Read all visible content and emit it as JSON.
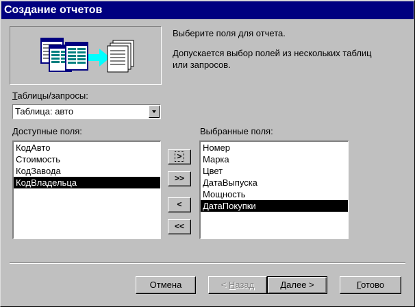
{
  "window": {
    "title": "Создание отчетов"
  },
  "intro": {
    "line1": "Выберите поля для отчета.",
    "line2": "Допускается выбор полей из нескольких таблиц",
    "line3": "или запросов."
  },
  "source": {
    "label_first": "Т",
    "label_rest": "аблицы/запросы:",
    "value": "Таблица: авто"
  },
  "available": {
    "label_first": "Д",
    "label_rest": "оступные поля:",
    "items": [
      "КодАвто",
      "Стоимость",
      "КодЗавода",
      "КодВладельца"
    ],
    "selected_index": 3
  },
  "chosen": {
    "label": "Выбранные поля:",
    "items": [
      "Номер",
      "Марка",
      "Цвет",
      "ДатаВыпуска",
      "Мощность",
      "ДатаПокупки"
    ],
    "selected_index": 5
  },
  "move_buttons": {
    "add": ">",
    "add_all": ">>",
    "remove": "<",
    "remove_all": "<<"
  },
  "footer": {
    "cancel": "Отмена",
    "back_prefix": "< ",
    "back_first": "Н",
    "back_rest": "азад",
    "next_first": "Д",
    "next_rest": "алее >",
    "finish_first": "Г",
    "finish_rest": "отово"
  },
  "colors": {
    "titlebar": "#000080",
    "dialog": "#c0c0c0",
    "selection": "#000000",
    "monitor": "#00ffff"
  }
}
